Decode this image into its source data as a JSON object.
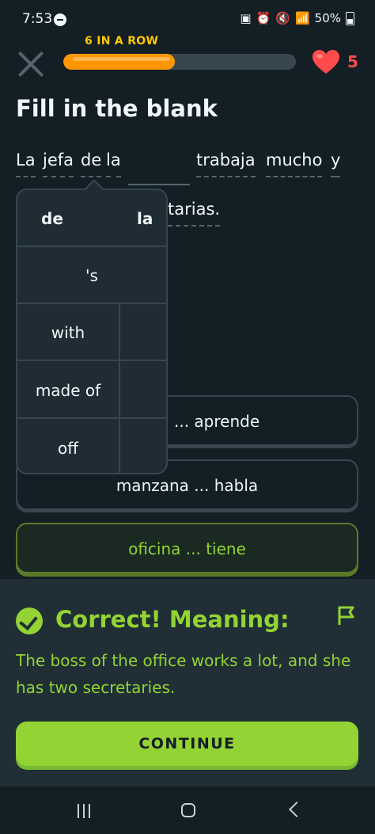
{
  "status_bar": {
    "time": "7:53",
    "battery": "50%",
    "icons": [
      "do-not-disturb-icon",
      "battery-saver-icon",
      "alarm-icon",
      "mute-icon",
      "wifi-icon",
      "signal-icon",
      "battery-icon"
    ]
  },
  "header": {
    "streak_label": "6 IN A ROW",
    "progress_fraction": 0.48,
    "hearts_count": "5",
    "colors": {
      "progress": "#ff9600",
      "streak": "#ffc800",
      "heart": "#ff4b4b"
    }
  },
  "exercise": {
    "title": "Fill in the blank",
    "sentence": {
      "w1": "La",
      "w2": "jefa",
      "w3": "de",
      "w4": "la",
      "w5": "trabaja",
      "w6": "mucho",
      "w7": "y",
      "w8": "tarias."
    }
  },
  "hint_popup": {
    "header": [
      "de",
      "la"
    ],
    "rows": [
      "'s",
      "with",
      "made of",
      "off"
    ]
  },
  "options": [
    {
      "text": "... aprende",
      "selected": false
    },
    {
      "text": "manzana ... habla",
      "selected": false
    },
    {
      "text": "oficina ... tiene",
      "selected": true
    }
  ],
  "feedback": {
    "title": "Correct! Meaning:",
    "translation": "The boss of the office works a lot, and she has two secretaries.",
    "continue_label": "CONTINUE",
    "colors": {
      "correct": "#93d333",
      "panel": "#202f36"
    }
  },
  "nav_bar": {
    "icons": [
      "recents-icon",
      "home-icon",
      "back-icon"
    ]
  }
}
